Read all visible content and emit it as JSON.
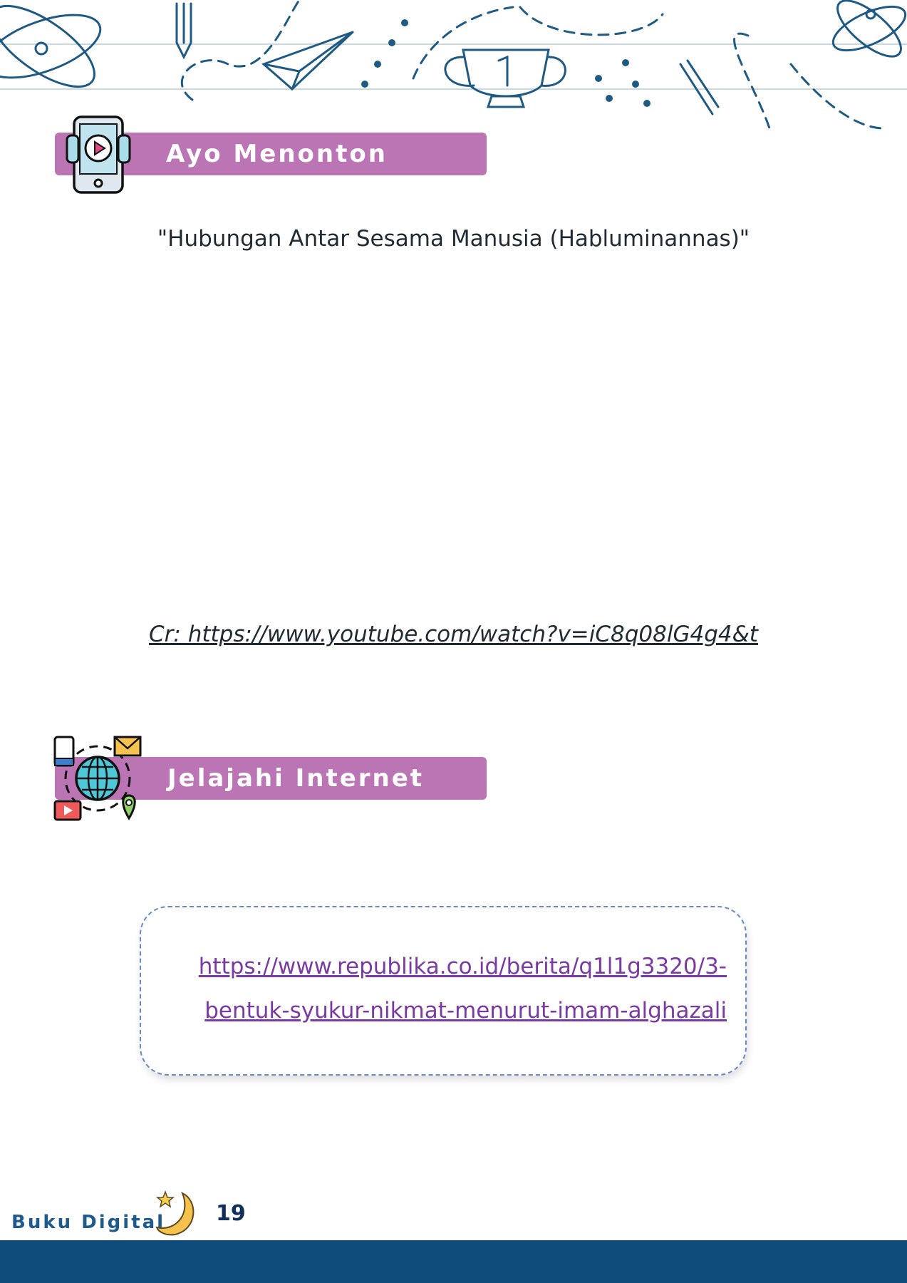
{
  "section_watch": {
    "heading": "Ayo Menonton",
    "icon": "smartphone-play-icon",
    "video_title": "\"Hubungan Antar Sesama Manusia (Habluminannas)\"",
    "credit": "Cr: https://www.youtube.com/watch?v=iC8q08lG4g4&t"
  },
  "section_internet": {
    "heading": "Jelajahi Internet",
    "icon": "globe-network-icon",
    "link_line1": " https://www.republika.co.id/berita/q1l1g3320/3-",
    "link_line2": "bentuk-syukur-nikmat-menurut-imam-alghazali"
  },
  "footer": {
    "brand": "Buku Digital",
    "page_number": "19",
    "icon": "moon-star-icon"
  },
  "colors": {
    "banner": "#bb74b4",
    "footer_bar": "#0f4c7c",
    "link": "#7b3aa3",
    "doodle": "#1e5a84"
  }
}
